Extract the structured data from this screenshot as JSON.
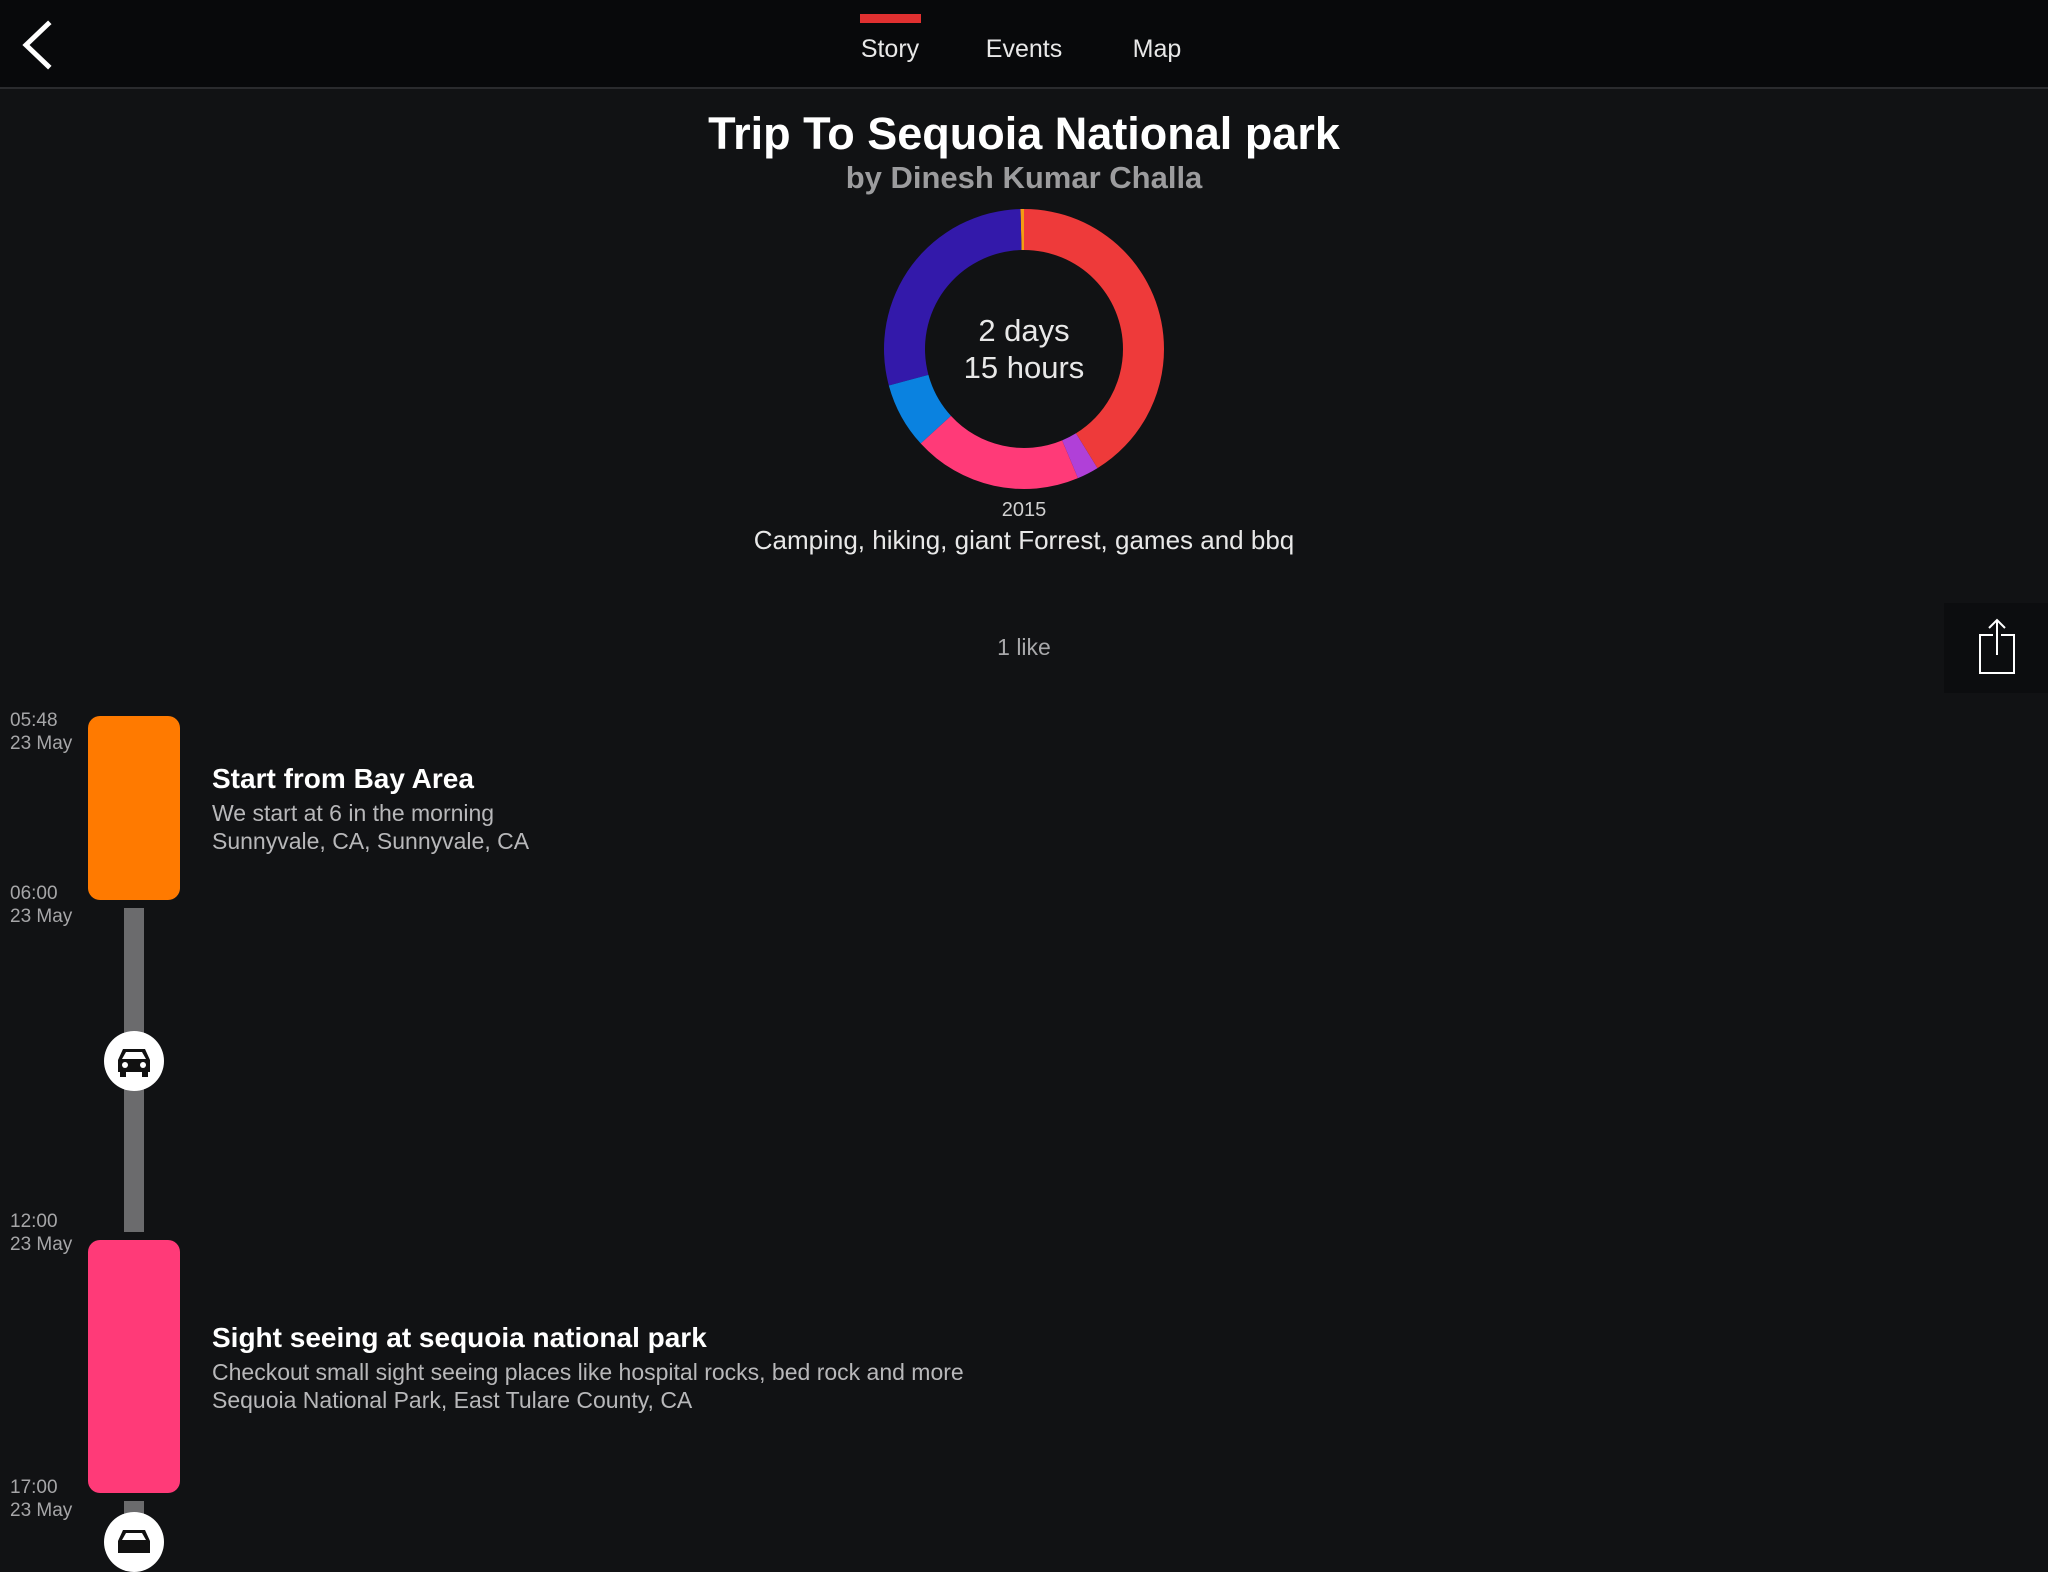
{
  "header": {
    "tabs": [
      {
        "label": "Story",
        "active": true
      },
      {
        "label": "Events",
        "active": false
      },
      {
        "label": "Map",
        "active": false
      }
    ],
    "indicator_color": "#e03030"
  },
  "story": {
    "title": "Trip To Sequoia National park",
    "author": "by Dinesh Kumar Challa",
    "duration_days": "2 days",
    "duration_hours": "15 hours",
    "year": "2015",
    "description": "Camping, hiking, giant Forrest, games and bbq",
    "likes": "1 like"
  },
  "duration_ring": {
    "segments": [
      {
        "color": "#ee3a3a",
        "fraction": 0.25
      },
      {
        "color": "#f39c12",
        "fraction": 0.004
      },
      {
        "color": "#3319aa",
        "fraction": 0.288
      },
      {
        "color": "#0a82e0",
        "fraction": 0.076
      },
      {
        "color": "#ff3a78",
        "fraction": 0.195
      },
      {
        "color": "#b040d8",
        "fraction": 0.025
      },
      {
        "color": "#ee3a3a",
        "fraction": 0.162
      }
    ]
  },
  "timeline": {
    "events": [
      {
        "start_time": "05:48",
        "start_date": "23 May",
        "end_time": "06:00",
        "end_date": "23 May",
        "color": "#ff7a00",
        "title": "Start from Bay Area",
        "description": "We start at 6 in the morning",
        "location": "Sunnyvale, CA, Sunnyvale, CA"
      },
      {
        "start_time": "12:00",
        "start_date": "23 May",
        "end_time": "17:00",
        "end_date": "23 May",
        "color": "#ff3a78",
        "title": "Sight seeing at sequoia national park",
        "description": "Checkout small sight seeing places like hospital rocks, bed rock and more",
        "location": "Sequoia National Park, East Tulare County, CA"
      }
    ],
    "transit_icon": "car-icon"
  }
}
